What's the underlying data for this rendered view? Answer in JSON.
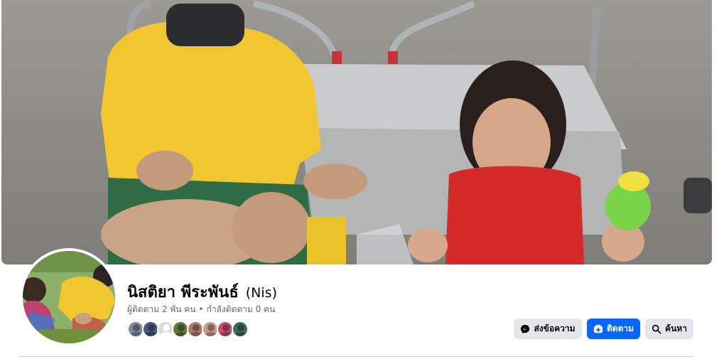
{
  "profile": {
    "name": "นิสติยา พีระพันธ์",
    "alternate_name": "(Nis)",
    "followers_text": "ผู้ติดตาม 2 พัน คน",
    "separator": "•",
    "following_text": "กำลังติดตาม 0 คน"
  },
  "friend_avatars": [
    {
      "color": "#7d8a9a"
    },
    {
      "color": "#4a5a7a"
    },
    {
      "color": "blank"
    },
    {
      "color": "#5e7a3c"
    },
    {
      "color": "#b07a6a"
    },
    {
      "color": "#c99a86"
    },
    {
      "color": "#c0506a"
    },
    {
      "color": "#3f6a5a"
    }
  ],
  "actions": {
    "message_label": "ส่งข้อความ",
    "follow_label": "ติดตาม",
    "search_label": "ค้นหา"
  },
  "icons": {
    "message": "messenger-icon",
    "follow": "follow-plus-icon",
    "search": "search-icon"
  },
  "colors": {
    "primary_button": "#0866ff",
    "secondary_button": "#e4e6eb",
    "secondary_text": "#65676b"
  }
}
